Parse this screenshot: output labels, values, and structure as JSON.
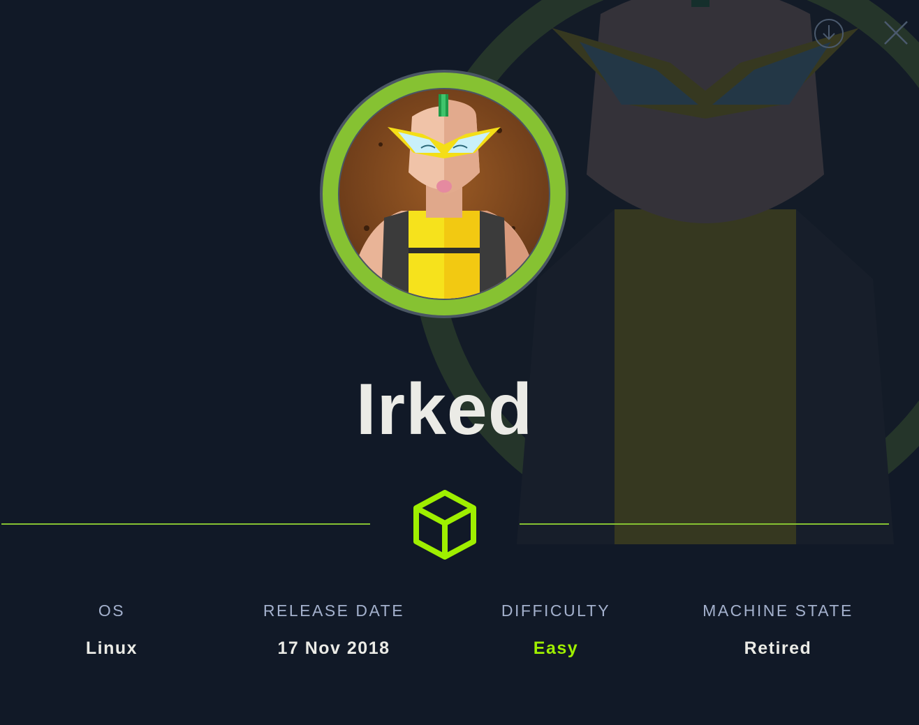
{
  "machine": {
    "name": "Irked"
  },
  "icons": {
    "download": "download-icon",
    "close": "close-icon",
    "cube": "cube-icon"
  },
  "stats": {
    "os": {
      "label": "OS",
      "value": "Linux"
    },
    "release_date": {
      "label": "RELEASE DATE",
      "value": "17 Nov 2018"
    },
    "difficulty": {
      "label": "DIFFICULTY",
      "value": "Easy"
    },
    "machine_state": {
      "label": "MACHINE STATE",
      "value": "Retired"
    }
  },
  "colors": {
    "background": "#111927",
    "accent_green": "#86c232",
    "easy_green": "#9fef00",
    "label": "#a4b1cd",
    "text": "#ebebe6"
  }
}
